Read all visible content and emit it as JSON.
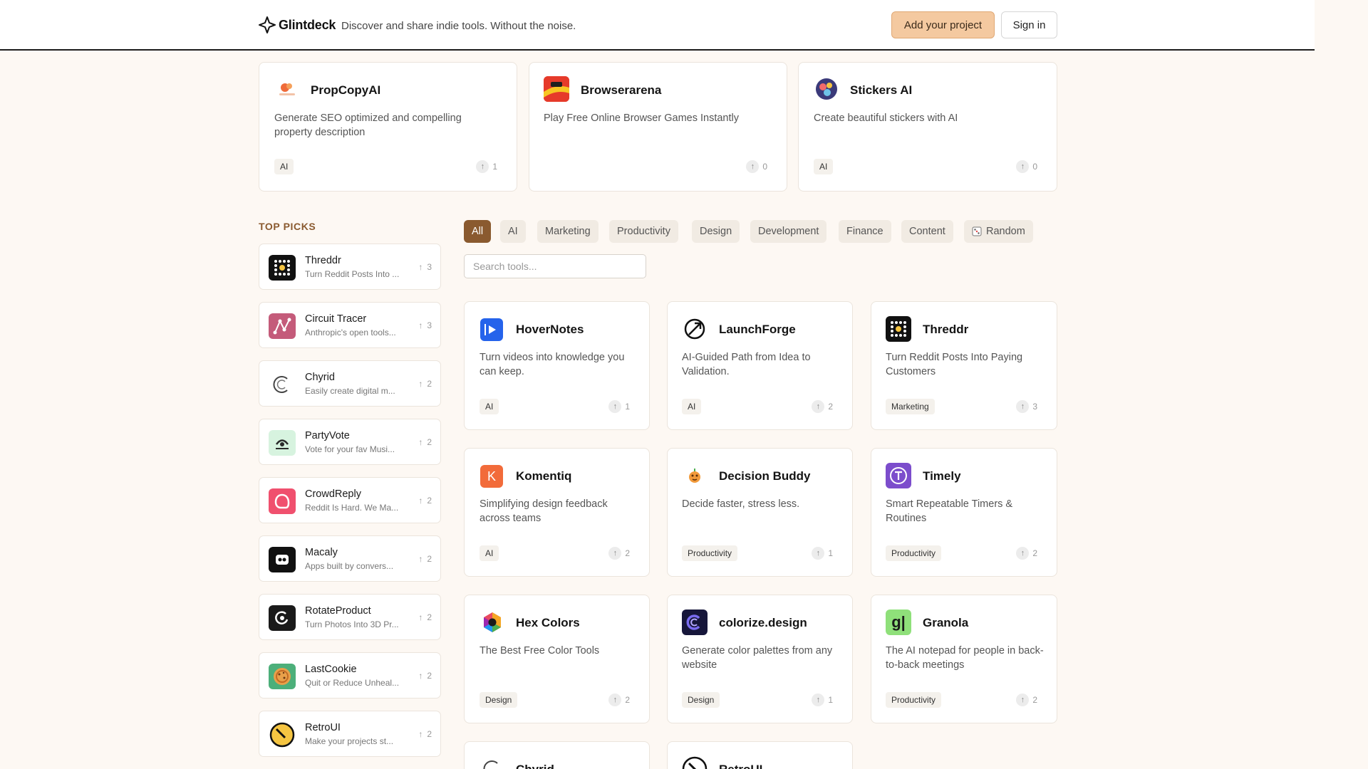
{
  "header": {
    "brand": "Glintdeck",
    "tagline": "Discover and share indie tools. Without the noise.",
    "add_label": "Add your project",
    "signin_label": "Sign in"
  },
  "featured": [
    {
      "title": "PropCopyAI",
      "desc": "Generate SEO optimized and compelling property description",
      "tag": "AI",
      "votes": "1",
      "icon": "propcopyai-logo-icon"
    },
    {
      "title": "Browserarena",
      "desc": "Play Free Online Browser Games Instantly",
      "tag": "",
      "votes": "0",
      "icon": "browserarena-logo-icon"
    },
    {
      "title": "Stickers AI",
      "desc": "Create beautiful stickers with AI",
      "tag": "AI",
      "votes": "0",
      "icon": "stickers-ai-logo-icon"
    }
  ],
  "top_picks": {
    "title": "TOP PICKS",
    "items": [
      {
        "name": "Threddr",
        "desc": "Turn Reddit Posts Into ...",
        "votes": "3"
      },
      {
        "name": "Circuit Tracer",
        "desc": "Anthropic's open tools...",
        "votes": "3"
      },
      {
        "name": "Chyrid",
        "desc": "Easily create digital m...",
        "votes": "2"
      },
      {
        "name": "PartyVote",
        "desc": "Vote for your fav Musi...",
        "votes": "2"
      },
      {
        "name": "CrowdReply",
        "desc": "Reddit Is Hard. We Ma...",
        "votes": "2"
      },
      {
        "name": "Macaly",
        "desc": "Apps built by convers...",
        "votes": "2"
      },
      {
        "name": "RotateProduct",
        "desc": "Turn Photos Into 3D Pr...",
        "votes": "2"
      },
      {
        "name": "LastCookie",
        "desc": "Quit or Reduce Unheal...",
        "votes": "2"
      },
      {
        "name": "RetroUI",
        "desc": "Make your projects st...",
        "votes": "2"
      }
    ]
  },
  "filters": [
    "All",
    "AI",
    "Marketing",
    "Productivity",
    "Design",
    "Development",
    "Finance",
    "Content",
    "Random"
  ],
  "search": {
    "placeholder": "Search tools..."
  },
  "tools": [
    {
      "title": "HoverNotes",
      "desc": "Turn videos into knowledge you can keep.",
      "tag": "AI",
      "votes": "1"
    },
    {
      "title": "LaunchForge",
      "desc": "AI-Guided Path from Idea to Validation.",
      "tag": "AI",
      "votes": "2"
    },
    {
      "title": "Threddr",
      "desc": "Turn Reddit Posts Into Paying Customers",
      "tag": "Marketing",
      "votes": "3"
    },
    {
      "title": "Komentiq",
      "desc": "Simplifying design feedback across teams",
      "tag": "AI",
      "votes": "2"
    },
    {
      "title": "Decision Buddy",
      "desc": "Decide faster, stress less.",
      "tag": "Productivity",
      "votes": "1"
    },
    {
      "title": "Timely",
      "desc": "Smart Repeatable Timers & Routines",
      "tag": "Productivity",
      "votes": "2"
    },
    {
      "title": "Hex Colors",
      "desc": "The Best Free Color Tools",
      "tag": "Design",
      "votes": "2"
    },
    {
      "title": "colorize.design",
      "desc": "Generate color palettes from any website",
      "tag": "Design",
      "votes": "1"
    },
    {
      "title": "Granola",
      "desc": "The AI notepad for people in back-to-back meetings",
      "tag": "Productivity",
      "votes": "2"
    },
    {
      "title": "Chyrid",
      "desc": "",
      "tag": "",
      "votes": ""
    },
    {
      "title": "RetroUI",
      "desc": "",
      "tag": "",
      "votes": ""
    }
  ],
  "colors": {
    "accent": "#8a5a2f",
    "add_button": "#f4c9a0",
    "background": "#fdf8f3"
  }
}
